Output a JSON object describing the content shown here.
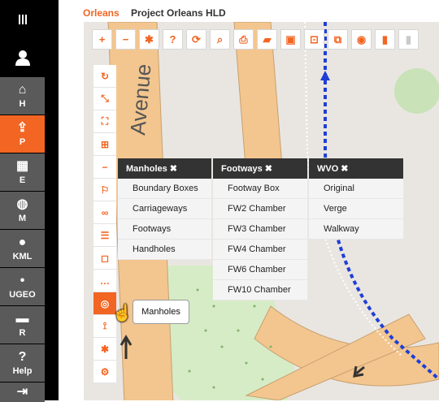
{
  "app": {
    "breadcrumb_project": "Orleans",
    "breadcrumb_title": "Project Orleans HLD"
  },
  "sidebar": {
    "menu_icon": "hamburger-icon",
    "user_icon": "user-icon",
    "items": [
      {
        "label": "H",
        "icon": "home-icon"
      },
      {
        "label": "P",
        "icon": "share-icon",
        "active": true
      },
      {
        "label": "E",
        "icon": "chip-icon"
      },
      {
        "label": "M",
        "icon": "globe-icon"
      },
      {
        "label": "KML",
        "icon": "map-pin-icon"
      },
      {
        "label": "UGEO",
        "icon": "pin-icon"
      },
      {
        "label": "R",
        "icon": "card-icon"
      },
      {
        "label": "Help",
        "icon": "question-icon"
      }
    ]
  },
  "toolbar": {
    "buttons": [
      "zoom-in-icon",
      "zoom-out-icon",
      "settings-icon",
      "help-icon",
      "refresh-icon",
      "search-icon",
      "print-icon",
      "ruler-icon",
      "layout-icon",
      "capture-icon",
      "screens-icon",
      "view-icon",
      "bookmark-icon",
      "bookmark-disabled-icon"
    ]
  },
  "vertical_tools": [
    "reload-icon",
    "collapse-icon",
    "fullscreen-icon",
    "table-icon",
    "minus-icon",
    "flag-icon",
    "tape-icon",
    "signpost-icon",
    "polygon-icon",
    "more-icon",
    "manholes-tool-icon",
    "antenna-icon",
    "asterisk-icon",
    "gear-icon"
  ],
  "dropdown": {
    "columns": [
      {
        "title": "Manholes",
        "items": [
          "Boundary Boxes",
          "Carriageways",
          "Footways",
          "Handholes"
        ]
      },
      {
        "title": "Footways",
        "items": [
          "Footway Box",
          "FW2 Chamber",
          "FW3 Chamber",
          "FW4 Chamber",
          "FW6 Chamber",
          "FW10 Chamber"
        ]
      },
      {
        "title": "WVO",
        "items": [
          "Original",
          "Verge",
          "Walkway"
        ]
      }
    ],
    "close_glyph": "✖"
  },
  "map": {
    "street_label": "Avenue"
  },
  "tooltip": {
    "text": "Manholes"
  },
  "colors": {
    "accent": "#f26522",
    "sidebar_bg": "#000000",
    "sidebar_item": "#5a5a5a",
    "road": "#f3c68f",
    "park": "#d6ecc6"
  }
}
